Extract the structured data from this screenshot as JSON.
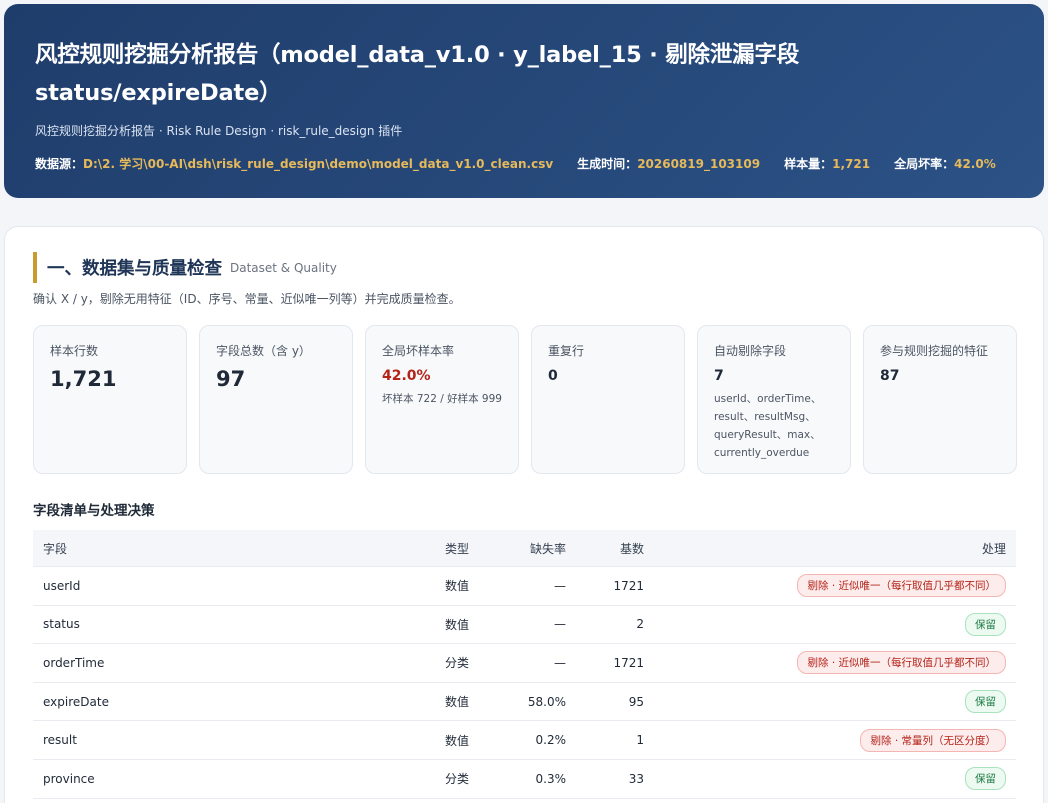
{
  "header": {
    "title": "风控规则挖掘分析报告（model_data_v1.0 · y_label_15 · 剔除泄漏字段 status/expireDate）",
    "subtitle": "风控规则挖掘分析报告 · Risk Rule Design · risk_rule_design 插件",
    "meta": [
      {
        "key": "数据源：",
        "value": "D:\\2. 学习\\00-AI\\dsh\\risk_rule_design\\demo\\model_data_v1.0_clean.csv"
      },
      {
        "key": "生成时间：",
        "value": "20260819_103109"
      },
      {
        "key": "样本量：",
        "value": "1,721"
      },
      {
        "key": "全局坏率：",
        "value": "42.0%"
      }
    ]
  },
  "section": {
    "title": "一、数据集与质量检查",
    "title_en": "Dataset & Quality",
    "desc": "确认 X / y，剔除无用特征（ID、序号、常量、近似唯一列等）并完成质量检查。"
  },
  "stats": [
    {
      "label": "样本行数",
      "value": "1,721",
      "note": ""
    },
    {
      "label": "字段总数（含 y）",
      "value": "97",
      "note": ""
    },
    {
      "label": "全局坏样本率",
      "value": "42.0%",
      "note": "坏样本 722 / 好样本 999"
    },
    {
      "label": "重复行",
      "value": "0",
      "note": ""
    },
    {
      "label": "自动剔除字段",
      "value": "7",
      "note": "userId、orderTime、result、resultMsg、queryResult、max、currently_overdue"
    },
    {
      "label": "参与规则挖掘的特征",
      "value": "87",
      "note": ""
    }
  ],
  "table": {
    "title": "字段清单与处理决策",
    "headers": {
      "field": "字段",
      "type": "类型",
      "missing": "缺失率",
      "cardinality": "基数",
      "action": "处理"
    },
    "rows": [
      {
        "field": "userId",
        "type": "数值",
        "missing": "—",
        "cardinality": "1721",
        "action": "剔除 · 近似唯一（每行取值几乎都不同）"
      },
      {
        "field": "status",
        "type": "数值",
        "missing": "—",
        "cardinality": "2",
        "action": "保留"
      },
      {
        "field": "orderTime",
        "type": "分类",
        "missing": "—",
        "cardinality": "1721",
        "action": "剔除 · 近似唯一（每行取值几乎都不同）"
      },
      {
        "field": "expireDate",
        "type": "数值",
        "missing": "58.0%",
        "cardinality": "95",
        "action": "保留"
      },
      {
        "field": "result",
        "type": "数值",
        "missing": "0.2%",
        "cardinality": "1",
        "action": "剔除 · 常量列（无区分度）"
      },
      {
        "field": "province",
        "type": "分类",
        "missing": "0.3%",
        "cardinality": "33",
        "action": "保留"
      }
    ]
  },
  "colors": {
    "header_bg": "#1f3d6b",
    "accent_gold": "#e6b95a",
    "bad_rate_red": "#b42318",
    "keep_green": "#1e7a44"
  }
}
